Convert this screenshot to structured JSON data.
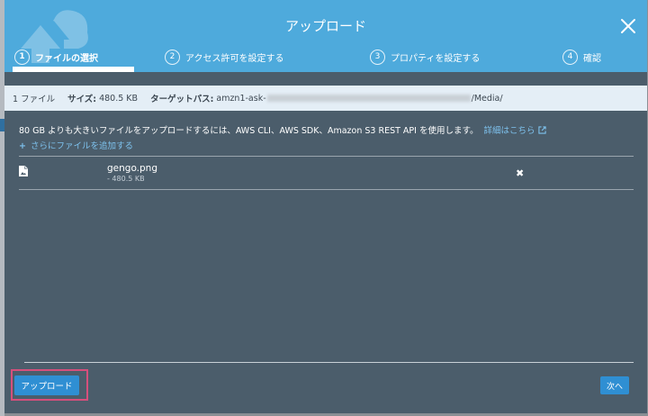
{
  "modal": {
    "title": "アップロード",
    "steps": [
      {
        "num": "1",
        "label": "ファイルの選択"
      },
      {
        "num": "2",
        "label": "アクセス許可を設定する"
      },
      {
        "num": "3",
        "label": "プロパティを設定する"
      },
      {
        "num": "4",
        "label": "確認"
      }
    ]
  },
  "info": {
    "file_count": "1 ファイル",
    "size_label": "サイズ:",
    "size_value": "480.5 KB",
    "target_label": "ターゲットパス:",
    "target_prefix": "amzn1-ask-",
    "target_suffix": "/Media/"
  },
  "notice": {
    "text": "80 GB よりも大きいファイルをアップロードするには、AWS CLI、AWS SDK、Amazon S3 REST API を使用します。",
    "link": "詳細はこちら"
  },
  "add_files": "さらにファイルを追加する",
  "file": {
    "name": "gengo.png",
    "size": "- 480.5 KB"
  },
  "buttons": {
    "upload": "アップロード",
    "next": "次へ"
  },
  "colors": {
    "header": "#4eaadc",
    "body": "#4b5d6b",
    "primary": "#2f8fd3",
    "highlight": "#d64f7c"
  }
}
